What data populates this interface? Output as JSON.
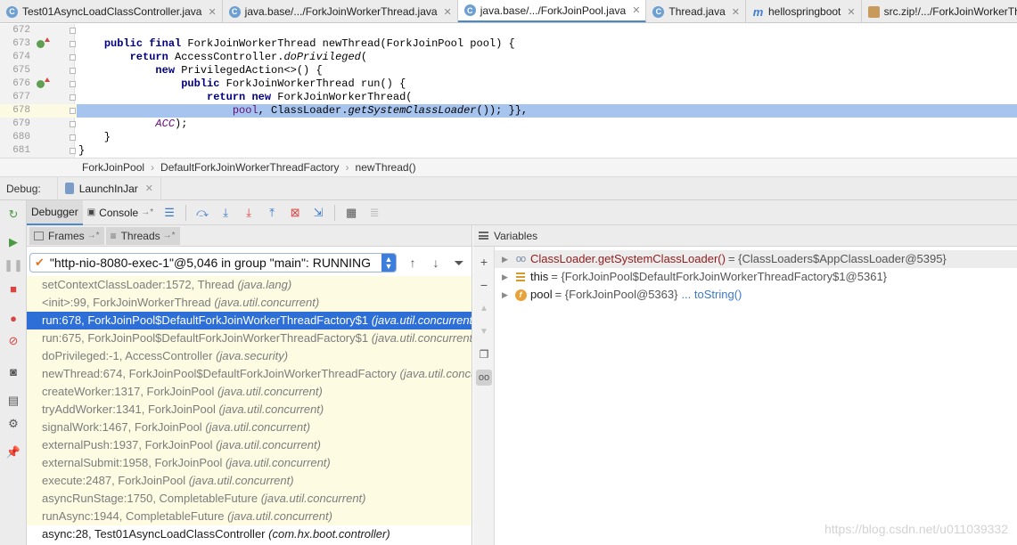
{
  "tabs": [
    {
      "icon": "C",
      "label": "Test01AsyncLoadClassController.java",
      "active": false
    },
    {
      "icon": "C",
      "label": "java.base/.../ForkJoinWorkerThread.java",
      "active": false
    },
    {
      "icon": "C",
      "label": "java.base/.../ForkJoinPool.java",
      "active": true
    },
    {
      "icon": "C",
      "label": "Thread.java",
      "active": false
    },
    {
      "icon": "m",
      "label": "hellospringboot",
      "active": false
    },
    {
      "icon": "zip",
      "label": "src.zip!/.../ForkJoinWorkerThrea",
      "active": false
    }
  ],
  "editor": {
    "lines": [
      {
        "num": "672",
        "html": ""
      },
      {
        "num": "673",
        "marker": true,
        "html": "    <span class='kw'>public final</span> ForkJoinWorkerThread newThread(ForkJoinPool pool) {"
      },
      {
        "num": "674",
        "html": "        <span class='kw'>return</span> AccessController.<span class='it'>doPrivileged</span>("
      },
      {
        "num": "675",
        "html": "            <span class='kw'>new</span> PrivilegedAction&lt;&gt;() {"
      },
      {
        "num": "676",
        "marker": true,
        "html": "                <span class='kw'>public</span> ForkJoinWorkerThread run() {"
      },
      {
        "num": "677",
        "html": "                    <span class='kw'>return new</span> ForkJoinWorkerThread("
      },
      {
        "num": "678",
        "current": true,
        "selected": true,
        "html": "                        <span class='pf'>pool</span>, ClassLoader.<span class='it'>getSystemClassLoader</span>()); }},"
      },
      {
        "num": "679",
        "html": "            <span class='pf it'>ACC</span>);"
      },
      {
        "num": "680",
        "html": "    }"
      },
      {
        "num": "681",
        "html": "}"
      }
    ]
  },
  "breadcrumb": [
    "ForkJoinPool",
    "DefaultForkJoinWorkerThreadFactory",
    "newThread()"
  ],
  "debug": {
    "label": "Debug:",
    "session": "LaunchInJar",
    "tab_debugger": "Debugger",
    "tab_console": "Console",
    "frames_tab": "Frames",
    "threads_tab": "Threads",
    "thread_selected": "\"http-nio-8080-exec-1\"@5,046 in group \"main\": RUNNING",
    "frames": [
      {
        "method": "setContextClassLoader:1572, Thread",
        "pkg": "(java.lang)",
        "state": "lib"
      },
      {
        "method": "<init>:99, ForkJoinWorkerThread",
        "pkg": "(java.util.concurrent)",
        "state": "lib"
      },
      {
        "method": "run:678, ForkJoinPool$DefaultForkJoinWorkerThreadFactory$1",
        "pkg": "(java.util.concurrent)",
        "state": "selected"
      },
      {
        "method": "run:675, ForkJoinPool$DefaultForkJoinWorkerThreadFactory$1",
        "pkg": "(java.util.concurrent)",
        "state": "lib"
      },
      {
        "method": "doPrivileged:-1, AccessController",
        "pkg": "(java.security)",
        "state": "lib"
      },
      {
        "method": "newThread:674, ForkJoinPool$DefaultForkJoinWorkerThreadFactory",
        "pkg": "(java.util.concurrent)",
        "state": "lib"
      },
      {
        "method": "createWorker:1317, ForkJoinPool",
        "pkg": "(java.util.concurrent)",
        "state": "lib"
      },
      {
        "method": "tryAddWorker:1341, ForkJoinPool",
        "pkg": "(java.util.concurrent)",
        "state": "lib"
      },
      {
        "method": "signalWork:1467, ForkJoinPool",
        "pkg": "(java.util.concurrent)",
        "state": "lib"
      },
      {
        "method": "externalPush:1937, ForkJoinPool",
        "pkg": "(java.util.concurrent)",
        "state": "lib"
      },
      {
        "method": "externalSubmit:1958, ForkJoinPool",
        "pkg": "(java.util.concurrent)",
        "state": "lib"
      },
      {
        "method": "execute:2487, ForkJoinPool",
        "pkg": "(java.util.concurrent)",
        "state": "lib"
      },
      {
        "method": "asyncRunStage:1750, CompletableFuture",
        "pkg": "(java.util.concurrent)",
        "state": "lib"
      },
      {
        "method": "runAsync:1944, CompletableFuture",
        "pkg": "(java.util.concurrent)",
        "state": "lib"
      },
      {
        "method": "async:28, Test01AsyncLoadClassController",
        "pkg": "(com.hx.boot.controller)",
        "state": "own"
      }
    ]
  },
  "variables": {
    "header": "Variables",
    "items": [
      {
        "kind": "watch",
        "icon": "glasses-icon",
        "name": "ClassLoader.getSystemClassLoader()",
        "value": "= {ClassLoaders$AppClassLoader@5395}",
        "link": ""
      },
      {
        "kind": "this",
        "icon": "object-icon",
        "name": "this",
        "value": "= {ForkJoinPool$DefaultForkJoinWorkerThreadFactory$1@5361}",
        "link": ""
      },
      {
        "kind": "field",
        "icon": "field-icon",
        "name": "pool",
        "value": "= {ForkJoinPool@5363}",
        "link": "... toString()"
      }
    ]
  },
  "watermark": "https://blog.csdn.net/u011039332",
  "colors": {
    "accent": "#4a88c7",
    "selection": "#2d6fd6",
    "frame_bg": "#fdfce3"
  }
}
